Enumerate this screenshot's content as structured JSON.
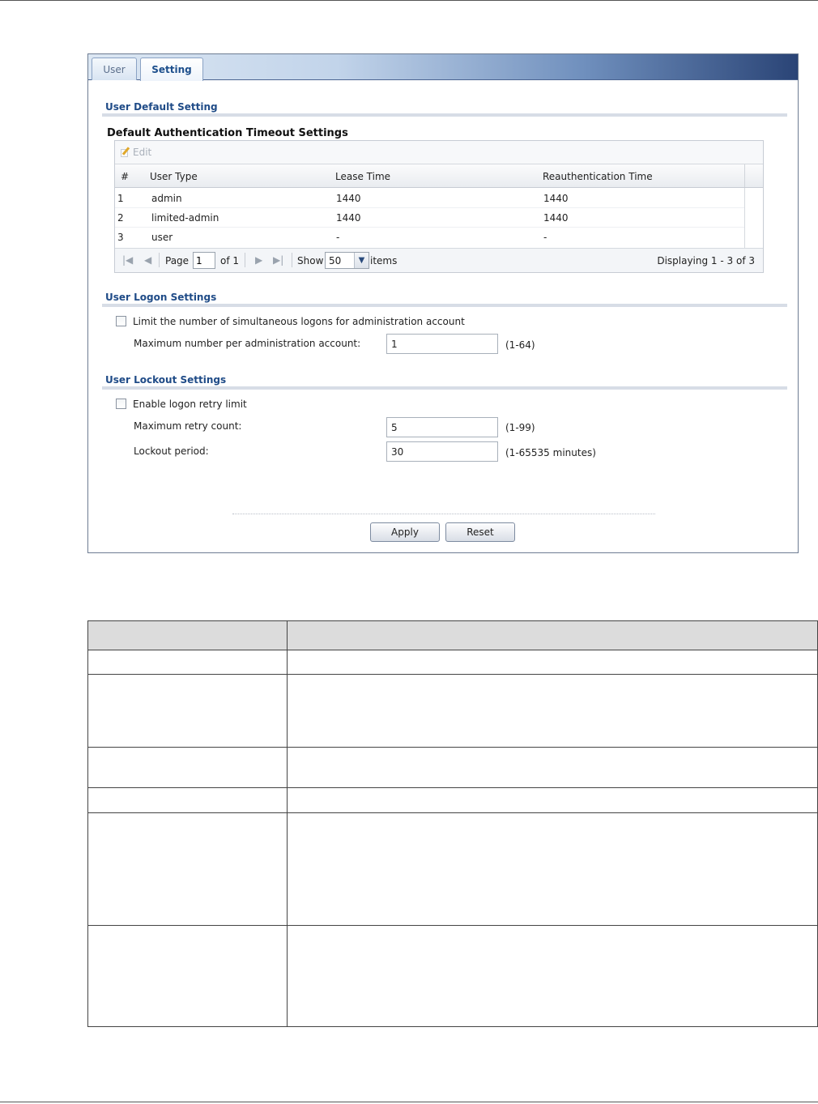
{
  "tabs": [
    {
      "label": "User"
    },
    {
      "label": "Setting"
    }
  ],
  "user_default": {
    "section_title": "User Default Setting",
    "subtitle": "Default Authentication Timeout Settings",
    "edit_label": "Edit",
    "columns": [
      "#",
      "User Type",
      "Lease Time",
      "Reauthentication Time"
    ],
    "rows": [
      {
        "num": "1",
        "type": "admin",
        "lease": "1440",
        "reauth": "1440"
      },
      {
        "num": "2",
        "type": "limited-admin",
        "lease": "1440",
        "reauth": "1440"
      },
      {
        "num": "3",
        "type": "user",
        "lease": "-",
        "reauth": "-"
      }
    ],
    "pager": {
      "page_label": "Page",
      "page_value": "1",
      "of_label": "of 1",
      "show_label": "Show",
      "show_value": "50",
      "items_label": "items",
      "displaying": "Displaying 1 - 3 of 3"
    }
  },
  "logon": {
    "section_title": "User Logon Settings",
    "limit_label": "Limit the number of simultaneous logons for administration account",
    "max_label": "Maximum number per administration account:",
    "max_value": "1",
    "max_range": "(1-64)"
  },
  "lockout": {
    "section_title": "User Lockout Settings",
    "enable_label": "Enable logon retry limit",
    "retry_label": "Maximum retry count:",
    "retry_value": "5",
    "retry_range": "(1-99)",
    "period_label": "Lockout period:",
    "period_value": "30",
    "period_range": "(1-65535 minutes)"
  },
  "buttons": {
    "apply": "Apply",
    "reset": "Reset"
  },
  "colors": {
    "section_title": "#1f4b87",
    "tab_gradient_end": "#2a4476"
  },
  "icons": {
    "edit": "edit-icon",
    "first": "first-page-icon",
    "prev": "prev-page-icon",
    "next": "next-page-icon",
    "last": "last-page-icon",
    "dropdown": "chevron-down-icon"
  }
}
